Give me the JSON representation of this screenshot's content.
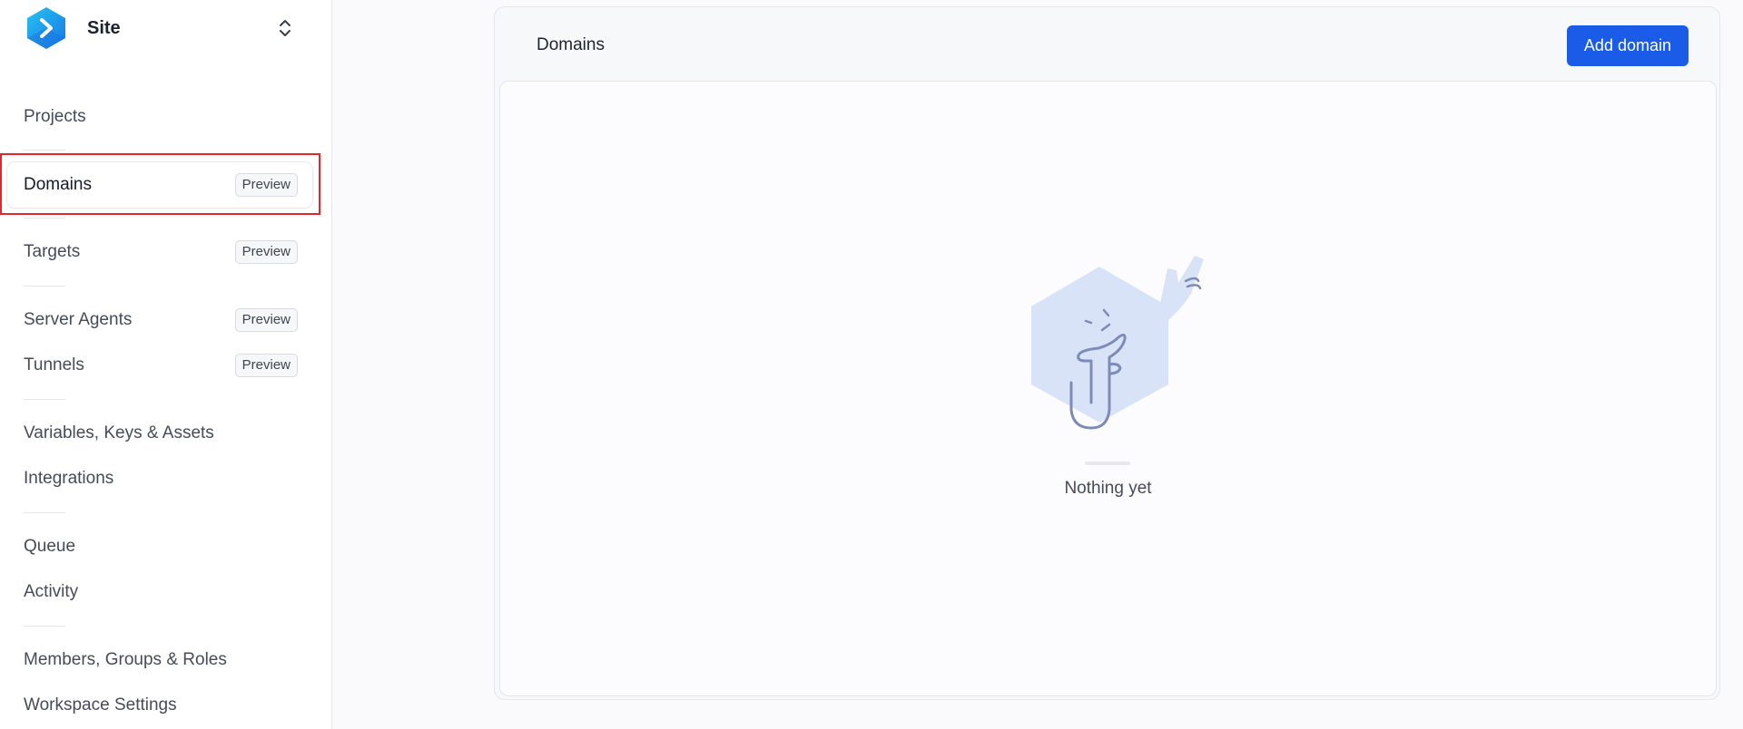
{
  "brand": {
    "name": "Site",
    "logo_icon": "hexagon-chevron-logo",
    "switch_icon": "chevron-up-down-icon"
  },
  "sidebar": {
    "items": [
      {
        "label": "Projects"
      },
      {
        "label": "Domains",
        "badge": "Preview",
        "active": true
      },
      {
        "label": "Targets",
        "badge": "Preview"
      },
      {
        "label": "Server Agents",
        "badge": "Preview"
      },
      {
        "label": "Tunnels",
        "badge": "Preview"
      },
      {
        "label": "Variables, Keys & Assets"
      },
      {
        "label": "Integrations"
      },
      {
        "label": "Queue"
      },
      {
        "label": "Activity"
      },
      {
        "label": "Members, Groups & Roles"
      },
      {
        "label": "Workspace Settings"
      }
    ]
  },
  "main": {
    "title": "Domains",
    "add_button": "Add domain",
    "empty_state": {
      "text": "Nothing yet",
      "illustration": "thinking-hexagon-illustration"
    }
  },
  "colors": {
    "accent": "#1a5ce8",
    "highlight": "#e0282e",
    "illustration": "#d9e3f7"
  }
}
